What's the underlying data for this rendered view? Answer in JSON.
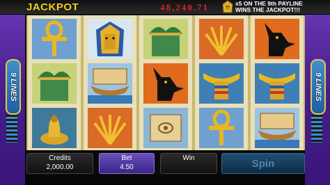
{
  "header": {
    "jackpot_label": "JACKPOT",
    "jackpot_value": "48,240.71",
    "jackpot_note_line1": "x5 ON THE 9th PAYLINE",
    "jackpot_note_line2": "WINS THE JACKPOT!!!",
    "note_icon": "pharaoh-icon"
  },
  "side": {
    "left_lines": "9 LINES",
    "right_lines": "9 LINES"
  },
  "reels": [
    [
      "ankh",
      "lotus-column",
      "cobra"
    ],
    [
      "pharaoh-mask",
      "boat",
      "wheat"
    ],
    [
      "lotus-column",
      "anubis",
      "papyrus-scroll"
    ],
    [
      "wheat",
      "scarab-collar",
      "ankh"
    ],
    [
      "anubis",
      "scarab-collar",
      "boat"
    ]
  ],
  "controls": {
    "credits_label": "Credits",
    "credits_value": "2,000.00",
    "bet_label": "Bet",
    "bet_value": "4.50",
    "win_label": "Win",
    "win_value": "",
    "spin_label": "Spin"
  },
  "colors": {
    "jackpot_text": "#f4d21a",
    "jackpot_value": "#d9222a",
    "frame": "#4a1f8e",
    "bet_panel": "#6b4dbb",
    "spin_button": "#1e4f72"
  }
}
